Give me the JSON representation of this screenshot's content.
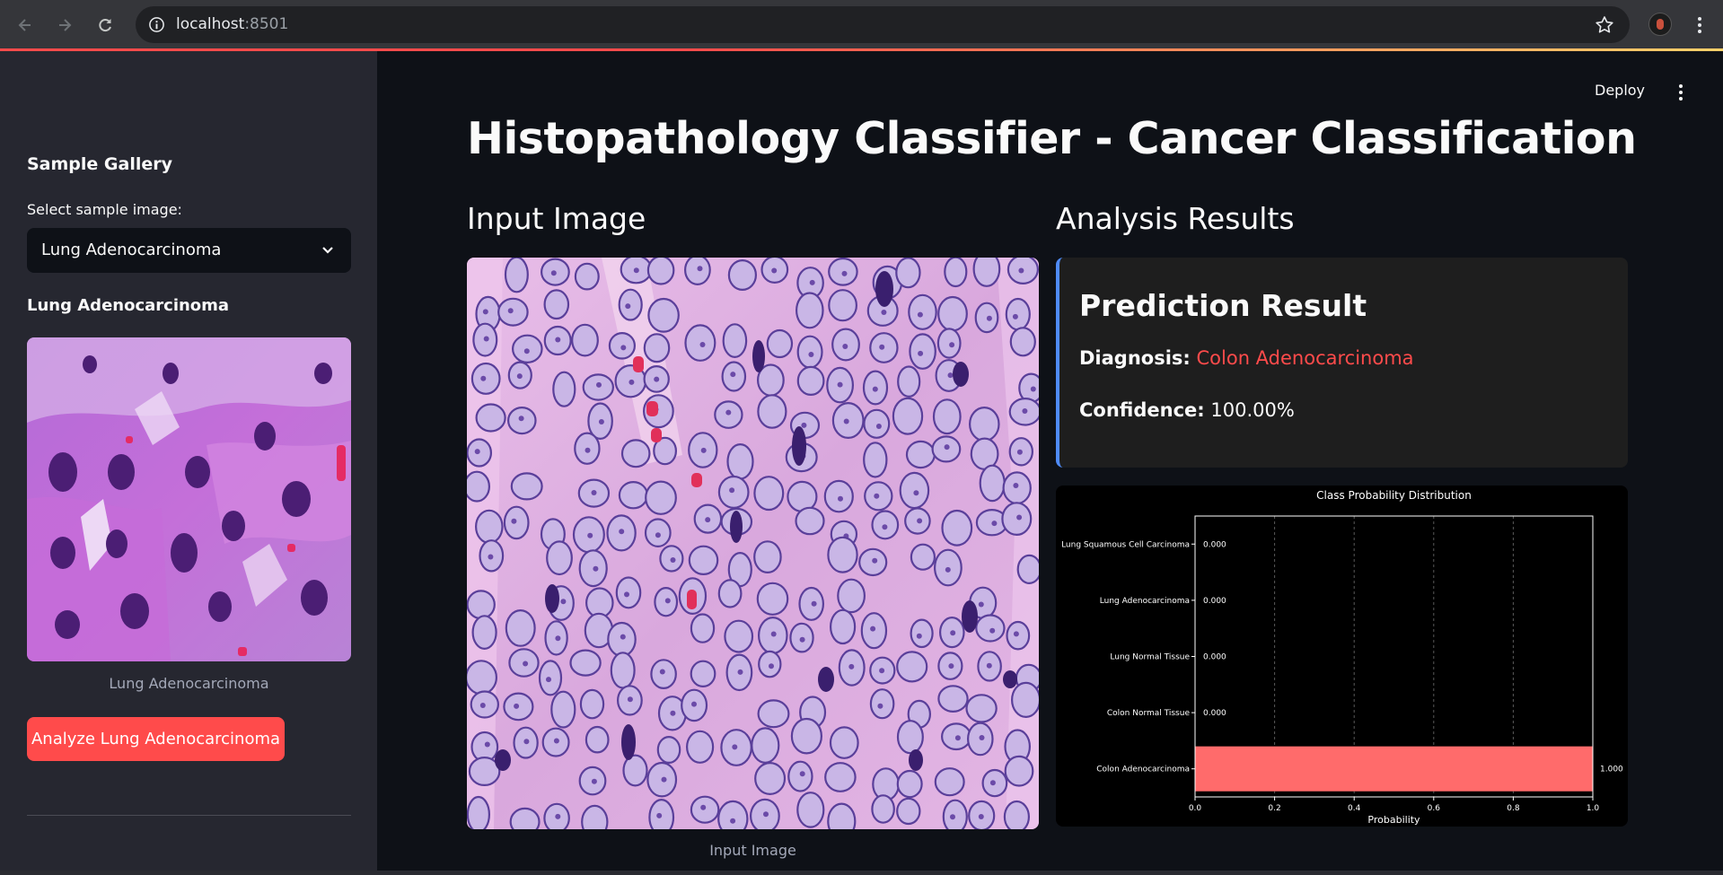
{
  "browser": {
    "url_host": "localhost",
    "url_port": ":8501"
  },
  "sidebar": {
    "title": "Sample Gallery",
    "select_label": "Select sample image:",
    "select_value": "Lung Adenocarcinoma",
    "subtitle": "Lung Adenocarcinoma",
    "image_caption": "Lung Adenocarcinoma",
    "analyze_button": "Analyze Lung Adenocarcinoma"
  },
  "header": {
    "deploy_label": "Deploy"
  },
  "main": {
    "title": "Histopathology Classifier - Cancer Classification",
    "input_title": "Input Image",
    "input_caption": "Input Image",
    "results_title": "Analysis Results",
    "result_card": {
      "heading": "Prediction Result",
      "diagnosis_label": "Diagnosis:",
      "diagnosis_value": "Colon Adenocarcinoma",
      "confidence_label": "Confidence:",
      "confidence_value": "100.00%"
    }
  },
  "colors": {
    "accent": "#ff4b4b",
    "card_border": "#4f8bf9",
    "background": "#0e1117",
    "sidebar": "#262730"
  },
  "chart_data": {
    "type": "bar",
    "orientation": "horizontal",
    "title": "Class Probability Distribution",
    "xlabel": "Probability",
    "ylabel": "",
    "xlim": [
      0,
      1.0
    ],
    "xticks": [
      "0.0",
      "0.2",
      "0.4",
      "0.6",
      "0.8",
      "1.0"
    ],
    "categories": [
      "Lung Squamous Cell Carcinoma",
      "Lung Adenocarcinoma",
      "Lung Normal Tissue",
      "Colon Normal Tissue",
      "Colon Adenocarcinoma"
    ],
    "values": [
      0.0,
      0.0,
      0.0,
      0.0,
      1.0
    ],
    "value_labels": [
      "0.000",
      "0.000",
      "0.000",
      "0.000",
      "1.000"
    ],
    "bar_color": "#ff6b6b",
    "grid": "vertical dashed"
  }
}
